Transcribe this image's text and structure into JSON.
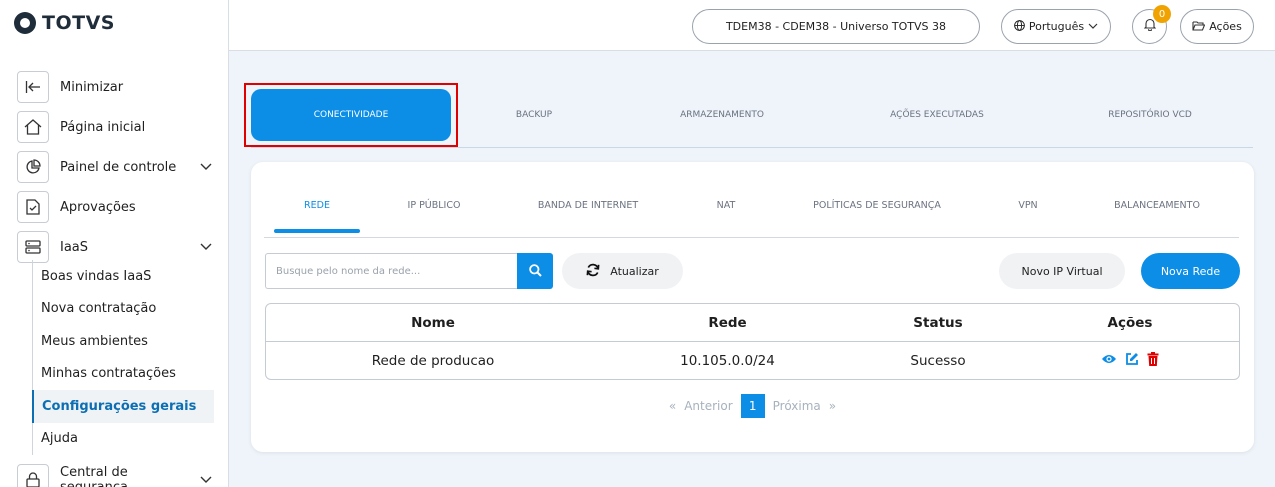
{
  "brand": {
    "name": "TOTVS"
  },
  "sidebar": {
    "items": [
      {
        "label": "Minimizar",
        "icon": "collapse-left-icon"
      },
      {
        "label": "Página inicial",
        "icon": "home-icon"
      },
      {
        "label": "Painel de controle",
        "icon": "pie-chart-icon"
      },
      {
        "label": "Aprovações",
        "icon": "file-check-icon"
      },
      {
        "label": "IaaS",
        "icon": "server-icon"
      }
    ],
    "sub_items": [
      {
        "label": "Boas vindas IaaS"
      },
      {
        "label": "Nova contratação"
      },
      {
        "label": "Meus ambientes"
      },
      {
        "label": "Minhas contratações"
      },
      {
        "label": "Configurações gerais"
      },
      {
        "label": "Ajuda"
      }
    ],
    "bottom_item": {
      "label": "Central de segurança",
      "icon": "lock-icon"
    }
  },
  "topbar": {
    "environment": "TDEM38 - CDEM38 - Universo TOTVS 38",
    "language": "Português",
    "notifications_count": "0",
    "actions_label": "Ações"
  },
  "top_tabs": [
    "CONECTIVIDADE",
    "BACKUP",
    "ARMAZENAMENTO",
    "AÇÕES EXECUTADAS",
    "REPOSITÓRIO VCD"
  ],
  "sub_tabs": [
    "REDE",
    "IP PÚBLICO",
    "BANDA DE INTERNET",
    "NAT",
    "POLÍTICAS DE SEGURANÇA",
    "VPN",
    "BALANCEAMENTO"
  ],
  "toolbar": {
    "search_placeholder": "Busque pelo nome da rede...",
    "refresh_label": "Atualizar",
    "new_virtual_ip_label": "Novo IP Virtual",
    "new_network_label": "Nova Rede"
  },
  "table": {
    "headers": [
      "Nome",
      "Rede",
      "Status",
      "Ações"
    ],
    "rows": [
      {
        "nome": "Rede de producao",
        "rede": "10.105.0.0/24",
        "status": "Sucesso"
      }
    ]
  },
  "pagination": {
    "first": "«",
    "prev": "Anterior",
    "current": "1",
    "next": "Próxima",
    "last": "»"
  },
  "colors": {
    "accent": "#0c8de6",
    "delete": "#e00000",
    "highlight": "#e00000",
    "badge": "#f0a300"
  }
}
